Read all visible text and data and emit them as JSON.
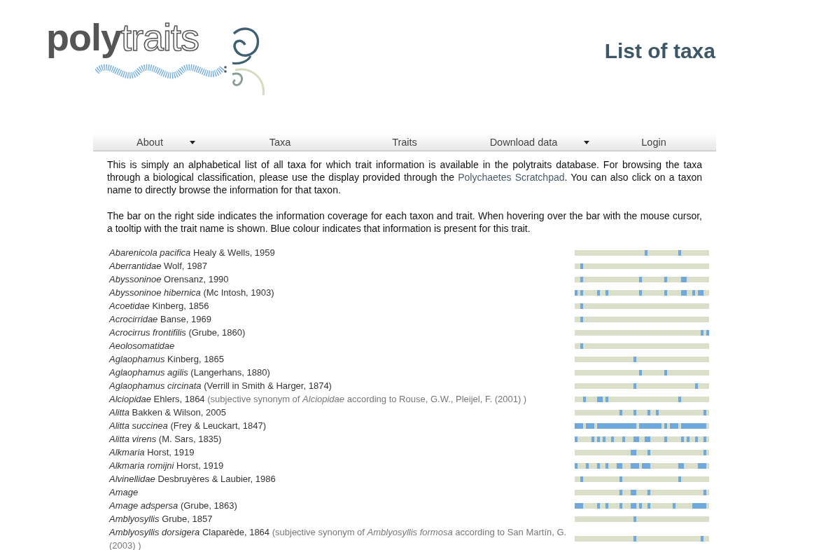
{
  "logo": {
    "bold_text": "poly",
    "outline_text": "traits"
  },
  "page_title": "List of taxa",
  "nav": [
    {
      "label": "About",
      "dropdown": true
    },
    {
      "label": "Taxa",
      "dropdown": false
    },
    {
      "label": "Traits",
      "dropdown": false
    },
    {
      "label": "Download data",
      "dropdown": true
    },
    {
      "label": "Login",
      "dropdown": false
    }
  ],
  "intro": [
    {
      "before": "This is simply an alphabetical list of all taxa for which trait information is available in the polytraits database. For browsing the taxa through a biological classification, please use the display provided through the ",
      "link": "Polychaetes Scratchpad",
      "after": ". You can also click on a taxon name to directly browse the information for that taxon."
    },
    {
      "before": "The bar on the right side indicates the information coverage for each taxon and trait. When hovering over the bar with the mouse cursor, a tooltip with the trait name is shown. Blue colour indicates that information is present for this trait."
    }
  ],
  "taxa": [
    {
      "name": "Abarenicola pacifica",
      "author": "Healy & Wells, 1959",
      "coverage": [
        false,
        false,
        false,
        false,
        false,
        false,
        false,
        false,
        false,
        false,
        false,
        false,
        false,
        false,
        false,
        false,
        false,
        false,
        false,
        false,
        false,
        false,
        false,
        false,
        false,
        true,
        false,
        false,
        false,
        false,
        false,
        false,
        false,
        false,
        false,
        false,
        false,
        true,
        false,
        false,
        false,
        false,
        false,
        false,
        false,
        false,
        false,
        false
      ]
    },
    {
      "name": "Aberrantidae",
      "author": "Wolf, 1987",
      "coverage": [
        false,
        false,
        true,
        false,
        false,
        false,
        false,
        false,
        false,
        false,
        false,
        false,
        false,
        false,
        false,
        false,
        false,
        false,
        false,
        false,
        false,
        false,
        false,
        false,
        false,
        false,
        false,
        false,
        false,
        false,
        false,
        false,
        false,
        false,
        false,
        false,
        false,
        false,
        false,
        false,
        false,
        false,
        false,
        false,
        false,
        false,
        false,
        false
      ]
    },
    {
      "name": "Abyssoninoe",
      "author": "Orensanz, 1990",
      "coverage": [
        false,
        false,
        true,
        false,
        false,
        false,
        false,
        false,
        false,
        false,
        false,
        false,
        false,
        false,
        false,
        false,
        false,
        false,
        false,
        false,
        false,
        false,
        false,
        true,
        false,
        false,
        false,
        false,
        false,
        false,
        false,
        false,
        true,
        false,
        false,
        false,
        false,
        false,
        true,
        true,
        false,
        false,
        false,
        false,
        false,
        false,
        false,
        false
      ]
    },
    {
      "name": "Abyssoninoe hibernica",
      "author": "(Mc Intosh, 1903)",
      "coverage": [
        true,
        false,
        true,
        false,
        false,
        false,
        false,
        false,
        true,
        false,
        false,
        true,
        false,
        false,
        false,
        false,
        false,
        false,
        false,
        false,
        false,
        false,
        false,
        true,
        false,
        false,
        false,
        false,
        false,
        false,
        false,
        false,
        true,
        false,
        false,
        false,
        false,
        false,
        true,
        true,
        false,
        false,
        true,
        false,
        true,
        true,
        false,
        false
      ]
    },
    {
      "name": "Acoetidae",
      "author": "Kinberg, 1856",
      "coverage": [
        false,
        false,
        true,
        false,
        false,
        false,
        false,
        false,
        false,
        false,
        false,
        false,
        false,
        false,
        false,
        false,
        false,
        false,
        false,
        false,
        false,
        false,
        false,
        false,
        false,
        false,
        false,
        false,
        false,
        false,
        false,
        false,
        false,
        false,
        false,
        false,
        false,
        false,
        false,
        false,
        false,
        false,
        false,
        false,
        false,
        false,
        false,
        false
      ]
    },
    {
      "name": "Acrocirridae",
      "author": "Banse, 1969",
      "coverage": [
        false,
        false,
        true,
        false,
        false,
        false,
        false,
        false,
        false,
        false,
        false,
        false,
        false,
        false,
        false,
        false,
        false,
        false,
        false,
        false,
        false,
        false,
        false,
        false,
        false,
        false,
        false,
        false,
        false,
        false,
        false,
        false,
        false,
        false,
        false,
        false,
        false,
        false,
        false,
        false,
        false,
        false,
        false,
        false,
        false,
        false,
        false,
        false
      ]
    },
    {
      "name": "Acrocirrus frontifilis",
      "author": "(Grube, 1860)",
      "coverage": [
        false,
        false,
        false,
        false,
        false,
        false,
        false,
        false,
        false,
        false,
        false,
        false,
        false,
        false,
        false,
        false,
        false,
        false,
        false,
        false,
        false,
        false,
        false,
        false,
        false,
        false,
        false,
        false,
        false,
        false,
        false,
        false,
        false,
        false,
        false,
        false,
        false,
        false,
        false,
        false,
        false,
        false,
        false,
        false,
        false,
        true,
        false,
        true
      ]
    },
    {
      "name": "Aeolosomatidae",
      "coverage": [
        false,
        false,
        true,
        false,
        false,
        false,
        false,
        false,
        false,
        false,
        false,
        false,
        false,
        false,
        false,
        false,
        false,
        false,
        false,
        false,
        false,
        false,
        false,
        false,
        false,
        false,
        false,
        false,
        false,
        false,
        false,
        false,
        false,
        false,
        false,
        false,
        false,
        false,
        false,
        false,
        false,
        false,
        false,
        false,
        false,
        false,
        false,
        false
      ]
    },
    {
      "name": "Aglaophamus",
      "author": "Kinberg, 1865",
      "coverage": [
        false,
        false,
        false,
        false,
        false,
        false,
        false,
        false,
        false,
        false,
        false,
        false,
        false,
        false,
        false,
        false,
        false,
        false,
        false,
        false,
        false,
        true,
        false,
        false,
        false,
        false,
        false,
        false,
        false,
        false,
        false,
        false,
        false,
        false,
        false,
        false,
        false,
        false,
        false,
        false,
        false,
        false,
        false,
        false,
        false,
        false,
        false,
        false
      ]
    },
    {
      "name": "Aglaophamus agilis",
      "author": "(Langerhans, 1880)",
      "coverage": [
        false,
        false,
        false,
        false,
        false,
        false,
        false,
        false,
        false,
        false,
        false,
        false,
        false,
        false,
        false,
        false,
        false,
        false,
        false,
        false,
        false,
        false,
        false,
        true,
        false,
        false,
        false,
        false,
        false,
        false,
        false,
        false,
        true,
        false,
        false,
        false,
        false,
        false,
        false,
        false,
        false,
        false,
        false,
        false,
        false,
        false,
        false,
        false
      ]
    },
    {
      "name": "Aglaophamus circinata",
      "author": "(Verrill in Smith & Harger, 1874)",
      "coverage": [
        false,
        false,
        false,
        false,
        false,
        false,
        false,
        false,
        false,
        false,
        false,
        false,
        false,
        false,
        false,
        false,
        false,
        false,
        false,
        false,
        false,
        true,
        false,
        false,
        false,
        false,
        false,
        false,
        false,
        false,
        false,
        false,
        false,
        false,
        false,
        false,
        false,
        false,
        false,
        false,
        false,
        false,
        false,
        true,
        false,
        false,
        false,
        false
      ]
    },
    {
      "name": "Alciopidae",
      "author": "Ehlers, 1864",
      "note": "(subjective synonym of *Alciopidae* according to Rouse, G.W., Pleijel, F. (2001) )",
      "coverage": [
        false,
        false,
        false,
        true,
        false,
        false,
        false,
        false,
        true,
        true,
        false,
        true,
        false,
        false,
        false,
        false,
        false,
        false,
        false,
        false,
        false,
        false,
        false,
        false,
        false,
        false,
        false,
        false,
        false,
        false,
        false,
        false,
        false,
        false,
        false,
        false,
        false,
        true,
        false,
        false,
        false,
        false,
        false,
        false,
        false,
        false,
        false,
        false
      ]
    },
    {
      "name": "Alitta",
      "author": "Bakken & Wilson, 2005",
      "coverage": [
        false,
        false,
        false,
        false,
        false,
        false,
        false,
        false,
        false,
        false,
        false,
        false,
        false,
        false,
        false,
        false,
        true,
        false,
        false,
        false,
        false,
        true,
        false,
        false,
        false,
        false,
        true,
        false,
        false,
        true,
        false,
        false,
        false,
        false,
        false,
        false,
        false,
        false,
        false,
        false,
        false,
        false,
        false,
        false,
        false,
        false,
        true,
        false
      ]
    },
    {
      "name": "Alitta succinea",
      "author": "(Frey & Leuckart, 1847)",
      "coverage": [
        true,
        true,
        true,
        false,
        true,
        true,
        true,
        false,
        true,
        true,
        true,
        true,
        true,
        true,
        true,
        true,
        true,
        true,
        true,
        true,
        true,
        true,
        false,
        true,
        true,
        true,
        true,
        true,
        true,
        true,
        true,
        false,
        true,
        false,
        true,
        true,
        true,
        false,
        true,
        true,
        true,
        true,
        true,
        true,
        true,
        true,
        true,
        false
      ]
    },
    {
      "name": "Alitta virens",
      "author": "(M. Sars, 1835)",
      "coverage": [
        true,
        false,
        false,
        false,
        false,
        false,
        true,
        false,
        true,
        false,
        true,
        false,
        false,
        true,
        false,
        false,
        false,
        true,
        false,
        false,
        false,
        true,
        true,
        false,
        false,
        true,
        true,
        false,
        false,
        false,
        false,
        false,
        true,
        false,
        false,
        false,
        false,
        false,
        true,
        false,
        true,
        false,
        false,
        true,
        false,
        false,
        true,
        false
      ]
    },
    {
      "name": "Alkmaria",
      "author": "Horst, 1919",
      "coverage": [
        false,
        false,
        false,
        false,
        false,
        false,
        false,
        false,
        false,
        false,
        false,
        false,
        false,
        false,
        false,
        false,
        false,
        false,
        false,
        false,
        true,
        true,
        false,
        false,
        false,
        false,
        true,
        false,
        false,
        false,
        false,
        false,
        false,
        false,
        false,
        false,
        false,
        false,
        false,
        false,
        false,
        false,
        false,
        false,
        false,
        false,
        true,
        false
      ]
    },
    {
      "name": "Alkmaria romijni",
      "author": "Horst, 1919",
      "coverage": [
        true,
        false,
        false,
        false,
        true,
        false,
        false,
        false,
        true,
        false,
        false,
        true,
        false,
        false,
        false,
        true,
        true,
        false,
        false,
        false,
        true,
        true,
        true,
        false,
        true,
        true,
        true,
        false,
        false,
        false,
        false,
        false,
        false,
        false,
        false,
        false,
        false,
        true,
        true,
        false,
        false,
        false,
        false,
        false,
        true,
        true,
        true,
        false
      ]
    },
    {
      "name": "Alvinellidae",
      "author": "Desbruyères & Laubier, 1986",
      "coverage": [
        false,
        false,
        true,
        false,
        false,
        false,
        false,
        false,
        false,
        false,
        false,
        false,
        false,
        false,
        false,
        false,
        true,
        false,
        false,
        false,
        false,
        false,
        false,
        false,
        false,
        false,
        false,
        false,
        false,
        false,
        false,
        false,
        false,
        false,
        false,
        false,
        false,
        true,
        false,
        false,
        false,
        false,
        false,
        false,
        false,
        false,
        false,
        false
      ]
    },
    {
      "name": "Amage",
      "coverage": [
        false,
        false,
        false,
        false,
        false,
        false,
        false,
        false,
        false,
        false,
        false,
        false,
        false,
        false,
        false,
        false,
        true,
        false,
        false,
        false,
        true,
        true,
        false,
        false,
        false,
        false,
        true,
        false,
        false,
        false,
        false,
        false,
        false,
        false,
        false,
        false,
        false,
        false,
        false,
        false,
        false,
        false,
        false,
        false,
        false,
        false,
        true,
        false
      ]
    },
    {
      "name": "Amage adspersa",
      "author": "(Grube, 1863)",
      "coverage": [
        true,
        true,
        true,
        false,
        false,
        false,
        false,
        false,
        true,
        false,
        false,
        true,
        false,
        false,
        false,
        false,
        true,
        false,
        false,
        false,
        true,
        true,
        false,
        true,
        false,
        false,
        true,
        false,
        false,
        false,
        false,
        false,
        false,
        false,
        false,
        true,
        false,
        false,
        false,
        false,
        false,
        false,
        true,
        true,
        true,
        true,
        true,
        false
      ]
    },
    {
      "name": "Amblyosyllis",
      "author": "Grube, 1857",
      "coverage": [
        false,
        false,
        false,
        false,
        false,
        false,
        false,
        false,
        false,
        false,
        false,
        false,
        false,
        false,
        false,
        false,
        false,
        false,
        false,
        false,
        false,
        true,
        false,
        false,
        false,
        false,
        false,
        false,
        false,
        false,
        false,
        false,
        false,
        false,
        false,
        false,
        false,
        false,
        false,
        false,
        false,
        false,
        false,
        false,
        false,
        false,
        false,
        false
      ]
    },
    {
      "name": "Amblyosyllis dorsigera",
      "author": "Claparède, 1864",
      "note": "(subjective synonym of *Amblyosyllis formosa* according to San Martín, G. (2003) )",
      "coverage": [
        false,
        false,
        false,
        false,
        false,
        false,
        false,
        false,
        false,
        false,
        false,
        false,
        false,
        false,
        false,
        false,
        false,
        false,
        false,
        false,
        false,
        true,
        false,
        false,
        false,
        false,
        false,
        false,
        false,
        false,
        false,
        false,
        false,
        false,
        false,
        false,
        false,
        false,
        false,
        false,
        false,
        false,
        false,
        false,
        false,
        true,
        false,
        false
      ]
    }
  ]
}
